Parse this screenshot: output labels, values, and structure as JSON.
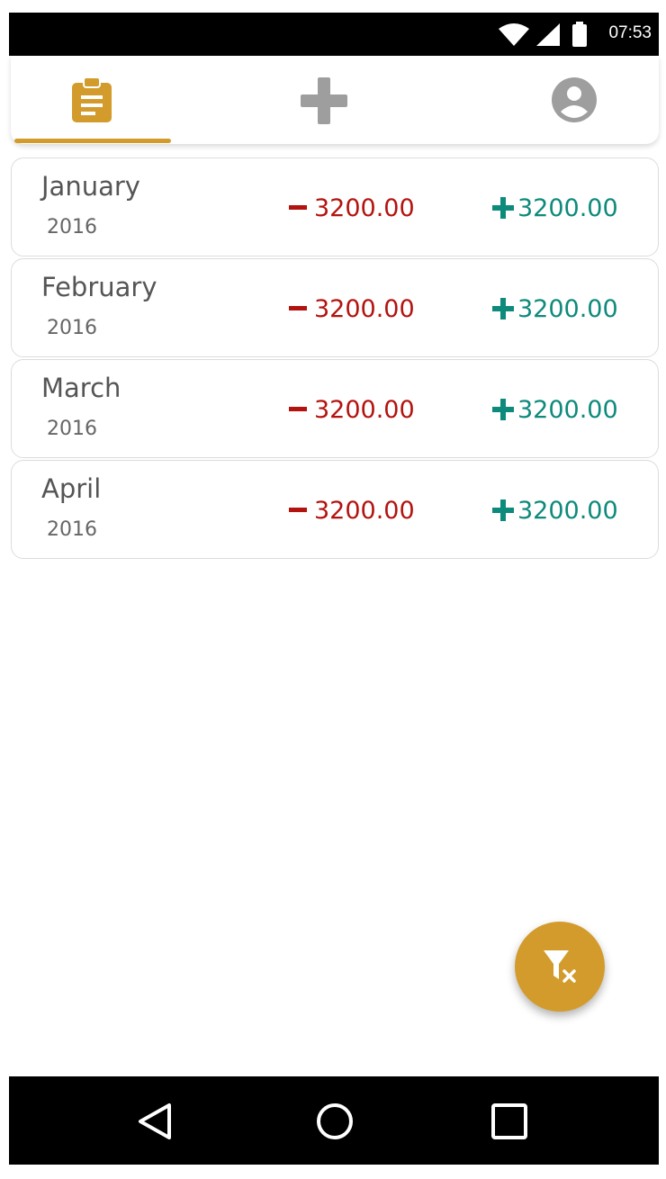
{
  "status_bar": {
    "time": "07:53",
    "icons": [
      "wifi-icon",
      "cell-signal-icon",
      "battery-icon"
    ]
  },
  "tabs": [
    {
      "name": "reports",
      "icon": "clipboard-icon",
      "active": true
    },
    {
      "name": "add",
      "icon": "plus-icon",
      "active": false
    },
    {
      "name": "profile",
      "icon": "account-circle-icon",
      "active": false
    }
  ],
  "colors": {
    "accent": "#d39b2b",
    "expense": "#b3130f",
    "income": "#0d8a7b",
    "inactive_icon": "#9e9e9e"
  },
  "months": [
    {
      "name": "January",
      "year": "2016",
      "expense": "3200.00",
      "income": "3200.00"
    },
    {
      "name": "February",
      "year": "2016",
      "expense": "3200.00",
      "income": "3200.00"
    },
    {
      "name": "March",
      "year": "2016",
      "expense": "3200.00",
      "income": "3200.00"
    },
    {
      "name": "April",
      "year": "2016",
      "expense": "3200.00",
      "income": "3200.00"
    }
  ],
  "fab": {
    "icon": "filter-clear-icon"
  },
  "nav_bar": {
    "icons": [
      "back-icon",
      "home-icon",
      "recents-icon"
    ]
  }
}
